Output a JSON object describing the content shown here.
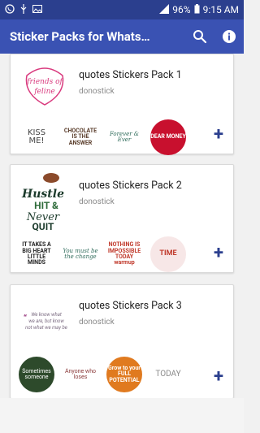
{
  "status_bar": {
    "battery": "96%",
    "time": "9:15 AM"
  },
  "app_bar": {
    "title": "Sticker Packs for Whats…",
    "actions": [
      "search-icon",
      "info-icon"
    ]
  },
  "packs": [
    {
      "title": "quotes Stickers Pack 1",
      "author": "donostick",
      "icon_text": "friends of feline",
      "stickers": [
        "KISS ME!",
        "CHOCOLATE IS THE ANSWER",
        "Forever & Ever",
        "DEAR MONEY"
      ]
    },
    {
      "title": "quotes Stickers Pack 2",
      "author": "donostick",
      "icon_text": "Hustle HIT & Never QUIT",
      "stickers": [
        "IT TAKES A BIG HEART LITTLE MINDS",
        "You must be the change",
        "NOTHING IS IMPOSSIBLE TODAY warmup",
        "TIME"
      ]
    },
    {
      "title": "quotes Stickers Pack 3",
      "author": "donostick",
      "icon_text": "We know what we are",
      "stickers": [
        "Sometimes someone",
        "Anyone who loses",
        "Grow to your FULL POTENTIAL",
        "TODAY"
      ]
    }
  ],
  "colors": {
    "status_bar": "#2b3f8e",
    "app_bar": "#3a52b3",
    "accent": "#2b3f8e"
  }
}
